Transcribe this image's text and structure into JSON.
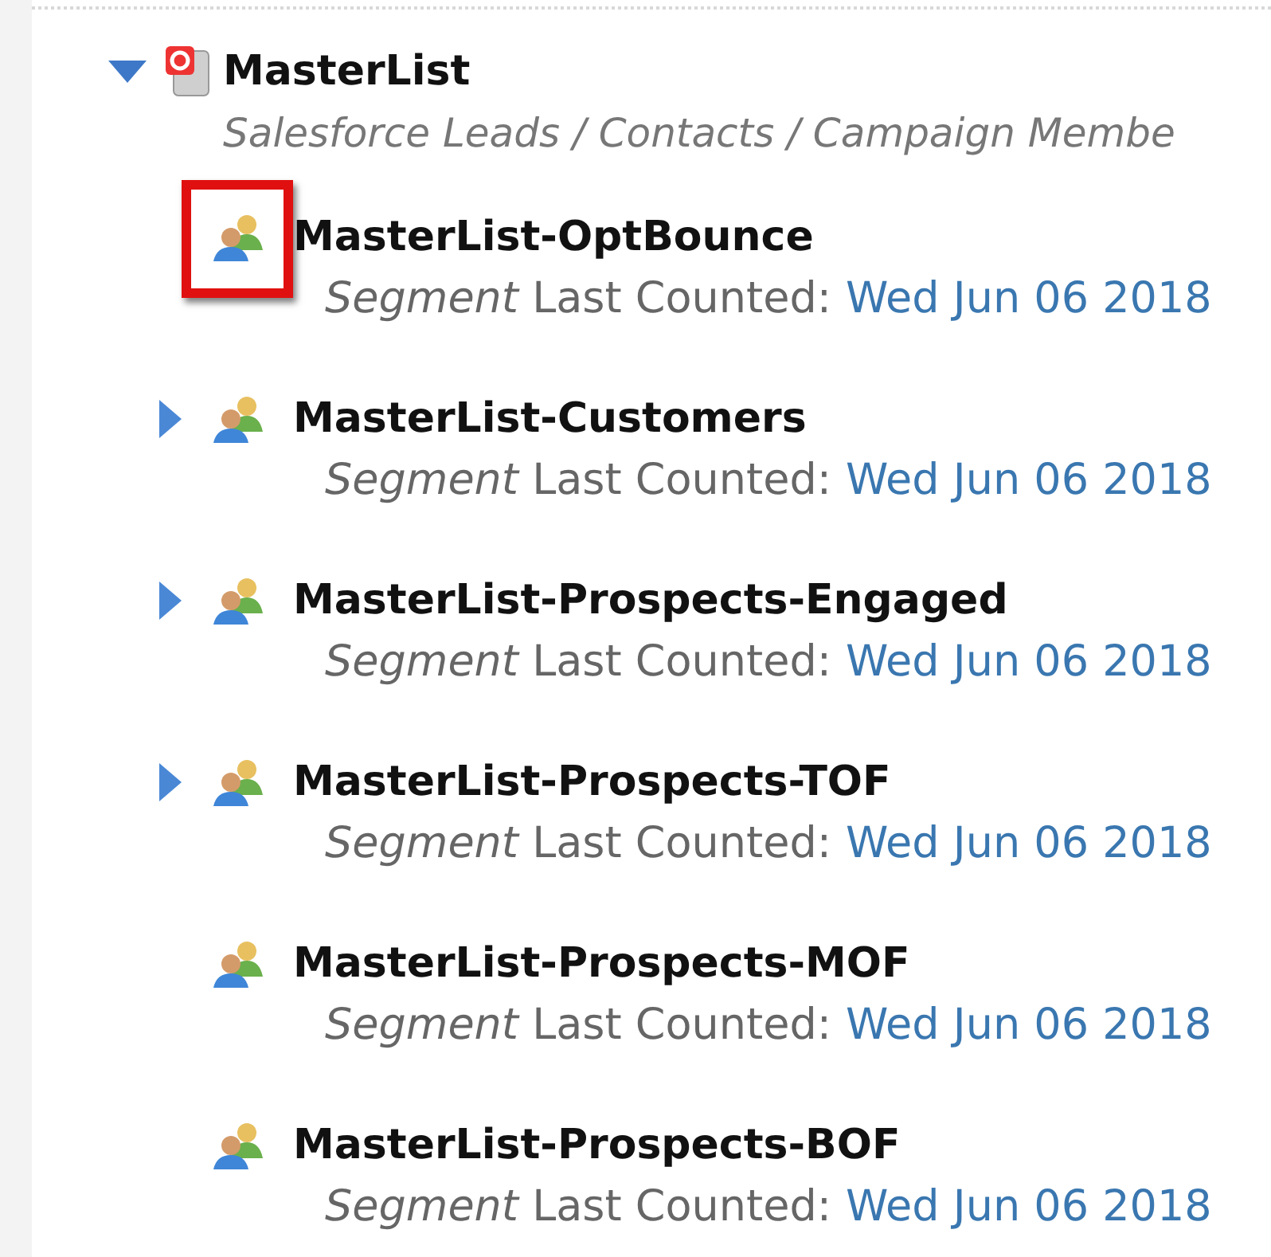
{
  "tree": {
    "label": "MasterList",
    "description": "Salesforce Leads / Contacts / Campaign Membe",
    "expanded": true,
    "children": [
      {
        "label": "MasterList-OptBounce",
        "meta": "*Segment* Last Counted:",
        "date": "Wed Jun 06 2018",
        "expandable": false,
        "highlighted": true
      },
      {
        "label": "MasterList-Customers",
        "meta": "*Segment* Last Counted:",
        "date": "Wed Jun 06 2018",
        "expandable": true,
        "highlighted": false
      },
      {
        "label": "MasterList-Prospects-Engaged",
        "meta": "*Segment* Last Counted:",
        "date": "Wed Jun 06 2018",
        "expandable": true,
        "highlighted": false
      },
      {
        "label": "MasterList-Prospects-TOF",
        "meta": "*Segment* Last Counted:",
        "date": "Wed Jun 06 2018",
        "expandable": true,
        "highlighted": false
      },
      {
        "label": "MasterList-Prospects-MOF",
        "meta": "*Segment* Last Counted:",
        "date": "Wed Jun 06 2018",
        "expandable": false,
        "highlighted": false
      },
      {
        "label": "MasterList-Prospects-BOF",
        "meta": "*Segment* Last Counted:",
        "date": "Wed Jun 06 2018",
        "expandable": false,
        "highlighted": false
      }
    ]
  }
}
